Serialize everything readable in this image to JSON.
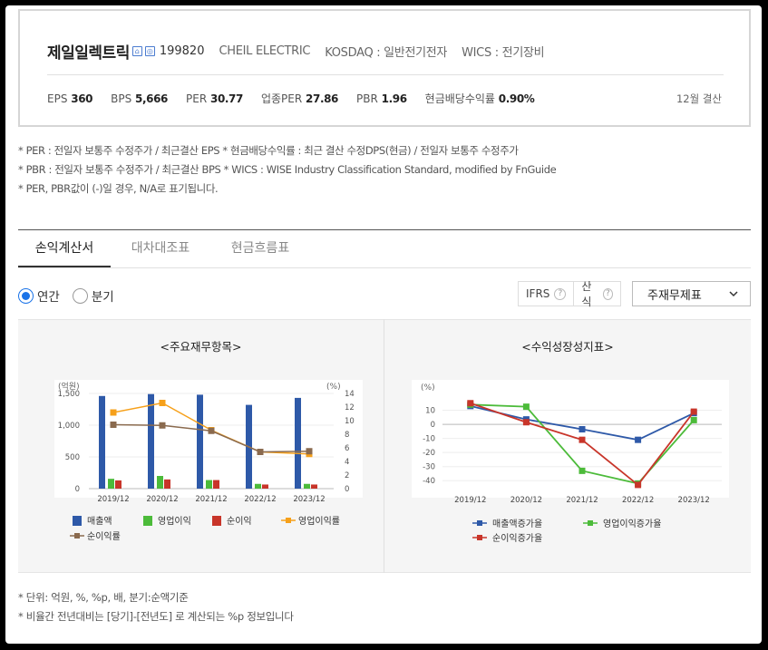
{
  "company": {
    "name": "제일일렉트릭",
    "code": "199820",
    "english_name": "CHEIL ELECTRIC",
    "market": "KOSDAQ : 일반전기전자",
    "wics": "WICS : 전기장비",
    "icon1": "house-icon",
    "icon2": "link-icon"
  },
  "metrics": [
    {
      "label": "EPS",
      "value": "360"
    },
    {
      "label": "BPS",
      "value": "5,666"
    },
    {
      "label": "PER",
      "value": "30.77"
    },
    {
      "label": "업종PER",
      "value": "27.86"
    },
    {
      "label": "PBR",
      "value": "1.96"
    },
    {
      "label": "현금배당수익률",
      "value": "0.90%"
    }
  ],
  "settlement": "12월 결산",
  "notes": [
    "* PER : 전일자 보통주 수정주가 / 최근결산 EPS * 현금배당수익률 : 최근 결산 수정DPS(현금) / 전일자 보통주 수정주가",
    "* PBR : 전일자 보통주 수정주가 / 최근결산 BPS * WICS : WISE Industry Classification Standard, modified by FnGuide",
    "* PER, PBR값이 (-)일 경우, N/A로 표기됩니다."
  ],
  "tabs": [
    "손익계산서",
    "대차대조표",
    "현금흐름표"
  ],
  "period": {
    "annual": "연간",
    "quarter": "분기",
    "selected": "annual"
  },
  "filters": {
    "ifrs": "IFRS",
    "ifrs_help": "?",
    "calc": "산식",
    "calc_help": "?"
  },
  "select_value": "주재무제표",
  "chart_data": [
    {
      "type": "bar",
      "title": "<주요재무항목>",
      "y_left_unit": "(억원)",
      "y_right_unit": "(%)",
      "ylim_left": [
        0,
        1500
      ],
      "ylim_right": [
        0,
        14
      ],
      "y_left_ticks": [
        "0",
        "500",
        "1,000",
        "1,500"
      ],
      "y_right_ticks": [
        "0",
        "2",
        "4",
        "6",
        "8",
        "10",
        "12",
        "14"
      ],
      "categories": [
        "2019/12",
        "2020/12",
        "2021/12",
        "2022/12",
        "2023/12"
      ],
      "series": [
        {
          "name": "매출액",
          "kind": "bar",
          "axis": "left",
          "color": "#2e59a8",
          "values": [
            1460,
            1490,
            1480,
            1320,
            1430
          ]
        },
        {
          "name": "영업이익",
          "kind": "bar",
          "axis": "left",
          "color": "#4cbb3a",
          "values": [
            155,
            200,
            135,
            75,
            75
          ]
        },
        {
          "name": "순이익",
          "kind": "bar",
          "axis": "left",
          "color": "#c8352a",
          "values": [
            130,
            145,
            135,
            65,
            65
          ]
        },
        {
          "name": "영업이익률",
          "kind": "line",
          "axis": "right",
          "color": "#f6a01a",
          "values": [
            11.2,
            12.6,
            8.6,
            5.4,
            5.1
          ]
        },
        {
          "name": "순이익률",
          "kind": "line",
          "axis": "right",
          "color": "#8a6a4e",
          "values": [
            9.4,
            9.3,
            8.5,
            5.4,
            5.5
          ]
        }
      ]
    },
    {
      "type": "line",
      "title": "<수익성장성지표>",
      "y_unit": "(%)",
      "ylim": [
        -45,
        20
      ],
      "y_ticks": [
        "-40",
        "-30",
        "-20",
        "-10",
        "0",
        "10"
      ],
      "categories": [
        "2019/12",
        "2020/12",
        "2021/12",
        "2022/12",
        "2023/12"
      ],
      "series": [
        {
          "name": "매출액증가율",
          "color": "#2e59a8",
          "values": [
            13,
            3.5,
            -3.5,
            -11,
            8
          ]
        },
        {
          "name": "영업이익증가율",
          "color": "#4cbb3a",
          "values": [
            14,
            12.5,
            -33,
            -42,
            3
          ]
        },
        {
          "name": "순이익증가율",
          "color": "#c8352a",
          "values": [
            15,
            1.5,
            -11,
            -43,
            9
          ]
        }
      ]
    }
  ],
  "bottom_notes": [
    "* 단위: 억원, %, %p, 배, 분기:순액기준",
    "* 비율간 전년대비는 [당기]-[전년도] 로 계산되는 %p 정보입니다"
  ]
}
